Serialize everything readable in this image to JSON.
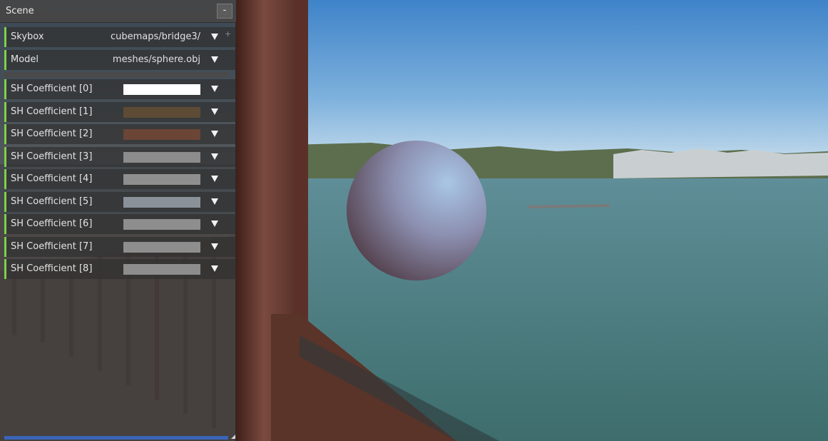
{
  "panel": {
    "title": "Scene",
    "collapse_label": "-"
  },
  "properties": [
    {
      "label": "Skybox",
      "value": "cubemaps/bridge3/"
    },
    {
      "label": "Model",
      "value": "meshes/sphere.obj"
    }
  ],
  "coefficients": [
    {
      "label": "SH Coefficient [0]",
      "color": "#ffffff"
    },
    {
      "label": "SH Coefficient [1]",
      "color": "#5d4b35"
    },
    {
      "label": "SH Coefficient [2]",
      "color": "#6b4535"
    },
    {
      "label": "SH Coefficient [3]",
      "color": "#8c8c8c"
    },
    {
      "label": "SH Coefficient [4]",
      "color": "#8f8f8f"
    },
    {
      "label": "SH Coefficient [5]",
      "color": "#8b9198"
    },
    {
      "label": "SH Coefficient [6]",
      "color": "#8e8e8e"
    },
    {
      "label": "SH Coefficient [7]",
      "color": "#8e8e8e"
    },
    {
      "label": "SH Coefficient [8]",
      "color": "#8d8d8d"
    }
  ],
  "icons": {
    "dropdown": "triangle-down-icon",
    "resize": "resize-grip-icon"
  },
  "colors": {
    "accent_bar": "#7ed04a",
    "progress": "#3a64b8"
  }
}
